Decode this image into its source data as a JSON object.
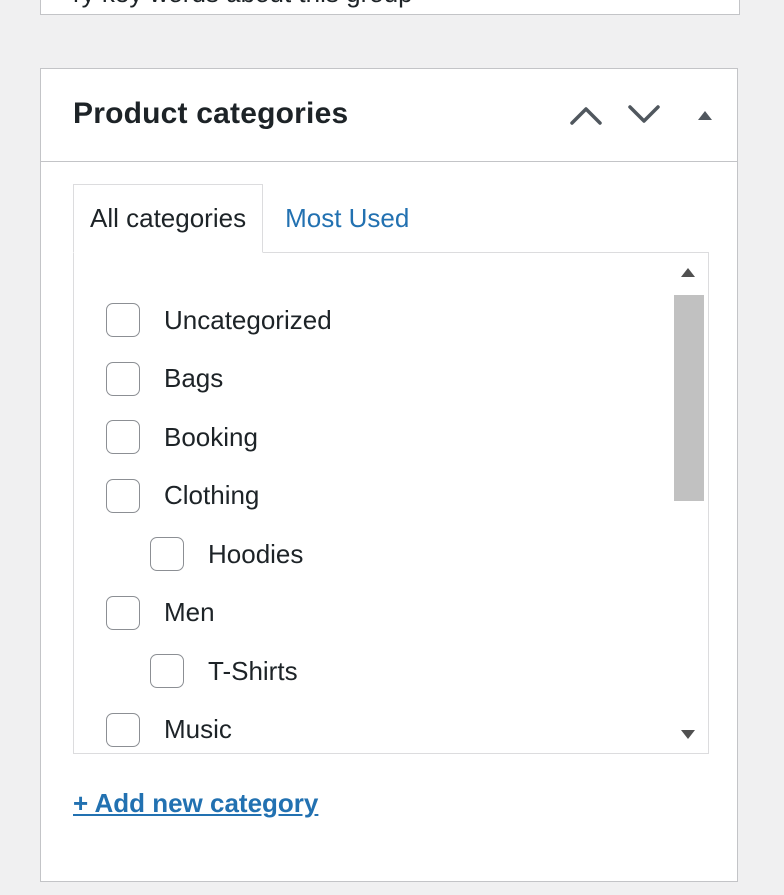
{
  "previous_box": {
    "clipped_text": "ry key words about this group"
  },
  "postbox": {
    "title": "Product categories",
    "handles": {
      "move_up_icon": "chevron-up-icon",
      "move_down_icon": "chevron-down-icon",
      "toggle_icon": "triangle-up-icon"
    },
    "tabs": [
      {
        "label": "All categories",
        "active": true
      },
      {
        "label": "Most Used",
        "active": false
      }
    ],
    "categories": [
      {
        "label": "Uncategorized",
        "level": 0,
        "checked": false
      },
      {
        "label": "Bags",
        "level": 0,
        "checked": false
      },
      {
        "label": "Booking",
        "level": 0,
        "checked": false
      },
      {
        "label": "Clothing",
        "level": 0,
        "checked": false
      },
      {
        "label": "Hoodies",
        "level": 1,
        "checked": false
      },
      {
        "label": "Men",
        "level": 0,
        "checked": false
      },
      {
        "label": "T-Shirts",
        "level": 1,
        "checked": false
      },
      {
        "label": "Music",
        "level": 0,
        "checked": false
      }
    ],
    "add_new_label": "+ Add new category"
  },
  "colors": {
    "background": "#f0f0f1",
    "link": "#2271b1",
    "border": "#c3c4c7",
    "text": "#1d2327",
    "scroll_thumb": "#c1c1c1"
  }
}
